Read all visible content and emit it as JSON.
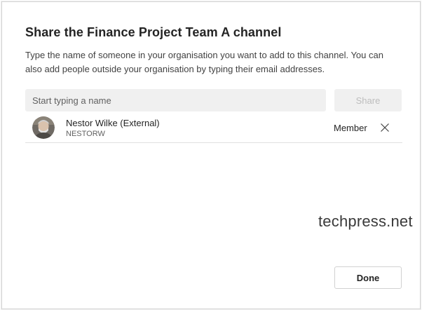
{
  "dialog": {
    "title": "Share the Finance Project Team A channel",
    "description": "Type the name of someone in your organisation you want to add to this channel. You can also add people outside your organisation by typing their email addresses."
  },
  "search": {
    "placeholder": "Start typing a name",
    "value": ""
  },
  "share_button": {
    "label": "Share",
    "enabled": false
  },
  "members": [
    {
      "name": "Nestor Wilke (External)",
      "username": "NESTORW",
      "role": "Member",
      "avatar_icon": "user-photo"
    }
  ],
  "remove_icon": "close-icon",
  "watermark": "techpress.net",
  "done_button": {
    "label": "Done"
  },
  "colors": {
    "input_background": "#f0f0f0",
    "disabled_text": "#bdbdbd",
    "text": "#242424",
    "secondary_text": "#616161",
    "divider": "#e0e0e0"
  }
}
